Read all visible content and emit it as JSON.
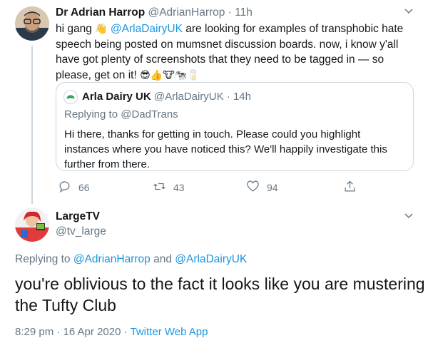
{
  "tweet": {
    "author_name": "Dr Adrian Harrop",
    "author_handle": "@AdrianHarrop",
    "time": "11h",
    "line1_a": "hi gang",
    "line1_mention": "@ArlaDairyUK",
    "line1_b": "are looking for examples of transphobic hate",
    "line2": "speech being posted on mumsnet discussion boards. now, i know y'all",
    "line3": "have got plenty of screenshots that they need to be tagged in — so",
    "line4": "please, get on it!",
    "emojis": [
      "😎",
      "👍",
      "🐮",
      "🐄",
      "🥛"
    ]
  },
  "quoted": {
    "author_name": "Arla Dairy UK",
    "author_handle": "@ArlaDairyUK",
    "time": "14h",
    "replying_to": "Replying to @DadTrans",
    "line1": "Hi there, thanks for getting in touch. Please could you highlight",
    "line2": "instances where you have noticed this? We'll happily investigate this",
    "line3": "further from there."
  },
  "actions": {
    "replies": "66",
    "retweets": "43",
    "likes": "94"
  },
  "reply": {
    "author_name": "LargeTV",
    "author_handle": "@tv_large",
    "replying_prefix": "Replying to",
    "replying_user1": "@AdrianHarrop",
    "replying_and": "and",
    "replying_user2": "@ArlaDairyUK",
    "line1": "you're oblivious to the fact it looks like you are mustering",
    "line2": "the Tufty Club",
    "timestamp": "8:29 pm · 16 Apr 2020 ·",
    "source": "Twitter Web App"
  },
  "colors": {
    "link": "#1b95e0",
    "muted": "#657786",
    "text": "#14171a",
    "border": "#ccd6dd"
  },
  "icons": [
    "chevron-down-icon",
    "reply-icon",
    "retweet-icon",
    "like-icon",
    "share-icon",
    "arla-logo-icon"
  ]
}
